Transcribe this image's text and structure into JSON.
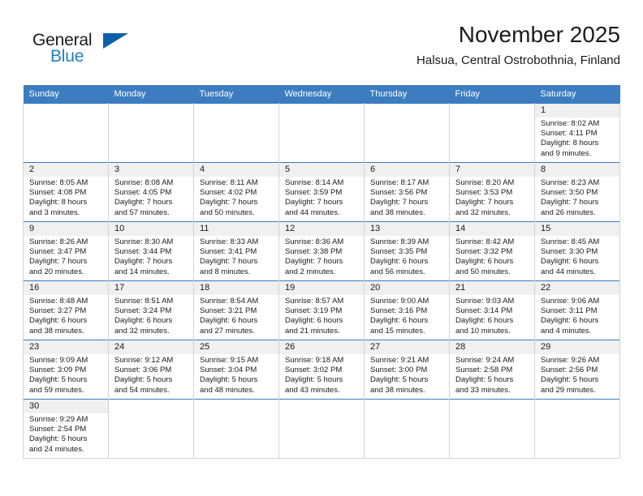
{
  "brand": {
    "name_top": "General",
    "name_bottom": "Blue",
    "accent_color": "#1f7fc4",
    "triangle_color": "#0c60aa",
    "triangle_icon": "triangle-icon"
  },
  "header": {
    "title": "November 2025",
    "subtitle": "Halsua, Central Ostrobothnia, Finland"
  },
  "calendar": {
    "header_bg": "#3b7dc0",
    "daynum_bg": "#f0f0f0",
    "grid_line": "#d4d4d4",
    "weekday_headers": [
      "Sunday",
      "Monday",
      "Tuesday",
      "Wednesday",
      "Thursday",
      "Friday",
      "Saturday"
    ],
    "weeks": [
      [
        {
          "blank": true
        },
        {
          "blank": true
        },
        {
          "blank": true
        },
        {
          "blank": true
        },
        {
          "blank": true
        },
        {
          "blank": true
        },
        {
          "day": "1",
          "sunrise": "Sunrise: 8:02 AM",
          "sunset": "Sunset: 4:11 PM",
          "daylight1": "Daylight: 8 hours",
          "daylight2": "and 9 minutes."
        }
      ],
      [
        {
          "day": "2",
          "sunrise": "Sunrise: 8:05 AM",
          "sunset": "Sunset: 4:08 PM",
          "daylight1": "Daylight: 8 hours",
          "daylight2": "and 3 minutes."
        },
        {
          "day": "3",
          "sunrise": "Sunrise: 8:08 AM",
          "sunset": "Sunset: 4:05 PM",
          "daylight1": "Daylight: 7 hours",
          "daylight2": "and 57 minutes."
        },
        {
          "day": "4",
          "sunrise": "Sunrise: 8:11 AM",
          "sunset": "Sunset: 4:02 PM",
          "daylight1": "Daylight: 7 hours",
          "daylight2": "and 50 minutes."
        },
        {
          "day": "5",
          "sunrise": "Sunrise: 8:14 AM",
          "sunset": "Sunset: 3:59 PM",
          "daylight1": "Daylight: 7 hours",
          "daylight2": "and 44 minutes."
        },
        {
          "day": "6",
          "sunrise": "Sunrise: 8:17 AM",
          "sunset": "Sunset: 3:56 PM",
          "daylight1": "Daylight: 7 hours",
          "daylight2": "and 38 minutes."
        },
        {
          "day": "7",
          "sunrise": "Sunrise: 8:20 AM",
          "sunset": "Sunset: 3:53 PM",
          "daylight1": "Daylight: 7 hours",
          "daylight2": "and 32 minutes."
        },
        {
          "day": "8",
          "sunrise": "Sunrise: 8:23 AM",
          "sunset": "Sunset: 3:50 PM",
          "daylight1": "Daylight: 7 hours",
          "daylight2": "and 26 minutes."
        }
      ],
      [
        {
          "day": "9",
          "sunrise": "Sunrise: 8:26 AM",
          "sunset": "Sunset: 3:47 PM",
          "daylight1": "Daylight: 7 hours",
          "daylight2": "and 20 minutes."
        },
        {
          "day": "10",
          "sunrise": "Sunrise: 8:30 AM",
          "sunset": "Sunset: 3:44 PM",
          "daylight1": "Daylight: 7 hours",
          "daylight2": "and 14 minutes."
        },
        {
          "day": "11",
          "sunrise": "Sunrise: 8:33 AM",
          "sunset": "Sunset: 3:41 PM",
          "daylight1": "Daylight: 7 hours",
          "daylight2": "and 8 minutes."
        },
        {
          "day": "12",
          "sunrise": "Sunrise: 8:36 AM",
          "sunset": "Sunset: 3:38 PM",
          "daylight1": "Daylight: 7 hours",
          "daylight2": "and 2 minutes."
        },
        {
          "day": "13",
          "sunrise": "Sunrise: 8:39 AM",
          "sunset": "Sunset: 3:35 PM",
          "daylight1": "Daylight: 6 hours",
          "daylight2": "and 56 minutes."
        },
        {
          "day": "14",
          "sunrise": "Sunrise: 8:42 AM",
          "sunset": "Sunset: 3:32 PM",
          "daylight1": "Daylight: 6 hours",
          "daylight2": "and 50 minutes."
        },
        {
          "day": "15",
          "sunrise": "Sunrise: 8:45 AM",
          "sunset": "Sunset: 3:30 PM",
          "daylight1": "Daylight: 6 hours",
          "daylight2": "and 44 minutes."
        }
      ],
      [
        {
          "day": "16",
          "sunrise": "Sunrise: 8:48 AM",
          "sunset": "Sunset: 3:27 PM",
          "daylight1": "Daylight: 6 hours",
          "daylight2": "and 38 minutes."
        },
        {
          "day": "17",
          "sunrise": "Sunrise: 8:51 AM",
          "sunset": "Sunset: 3:24 PM",
          "daylight1": "Daylight: 6 hours",
          "daylight2": "and 32 minutes."
        },
        {
          "day": "18",
          "sunrise": "Sunrise: 8:54 AM",
          "sunset": "Sunset: 3:21 PM",
          "daylight1": "Daylight: 6 hours",
          "daylight2": "and 27 minutes."
        },
        {
          "day": "19",
          "sunrise": "Sunrise: 8:57 AM",
          "sunset": "Sunset: 3:19 PM",
          "daylight1": "Daylight: 6 hours",
          "daylight2": "and 21 minutes."
        },
        {
          "day": "20",
          "sunrise": "Sunrise: 9:00 AM",
          "sunset": "Sunset: 3:16 PM",
          "daylight1": "Daylight: 6 hours",
          "daylight2": "and 15 minutes."
        },
        {
          "day": "21",
          "sunrise": "Sunrise: 9:03 AM",
          "sunset": "Sunset: 3:14 PM",
          "daylight1": "Daylight: 6 hours",
          "daylight2": "and 10 minutes."
        },
        {
          "day": "22",
          "sunrise": "Sunrise: 9:06 AM",
          "sunset": "Sunset: 3:11 PM",
          "daylight1": "Daylight: 6 hours",
          "daylight2": "and 4 minutes."
        }
      ],
      [
        {
          "day": "23",
          "sunrise": "Sunrise: 9:09 AM",
          "sunset": "Sunset: 3:09 PM",
          "daylight1": "Daylight: 5 hours",
          "daylight2": "and 59 minutes."
        },
        {
          "day": "24",
          "sunrise": "Sunrise: 9:12 AM",
          "sunset": "Sunset: 3:06 PM",
          "daylight1": "Daylight: 5 hours",
          "daylight2": "and 54 minutes."
        },
        {
          "day": "25",
          "sunrise": "Sunrise: 9:15 AM",
          "sunset": "Sunset: 3:04 PM",
          "daylight1": "Daylight: 5 hours",
          "daylight2": "and 48 minutes."
        },
        {
          "day": "26",
          "sunrise": "Sunrise: 9:18 AM",
          "sunset": "Sunset: 3:02 PM",
          "daylight1": "Daylight: 5 hours",
          "daylight2": "and 43 minutes."
        },
        {
          "day": "27",
          "sunrise": "Sunrise: 9:21 AM",
          "sunset": "Sunset: 3:00 PM",
          "daylight1": "Daylight: 5 hours",
          "daylight2": "and 38 minutes."
        },
        {
          "day": "28",
          "sunrise": "Sunrise: 9:24 AM",
          "sunset": "Sunset: 2:58 PM",
          "daylight1": "Daylight: 5 hours",
          "daylight2": "and 33 minutes."
        },
        {
          "day": "29",
          "sunrise": "Sunrise: 9:26 AM",
          "sunset": "Sunset: 2:56 PM",
          "daylight1": "Daylight: 5 hours",
          "daylight2": "and 29 minutes."
        }
      ],
      [
        {
          "day": "30",
          "sunrise": "Sunrise: 9:29 AM",
          "sunset": "Sunset: 2:54 PM",
          "daylight1": "Daylight: 5 hours",
          "daylight2": "and 24 minutes."
        },
        {
          "blank": true
        },
        {
          "blank": true
        },
        {
          "blank": true
        },
        {
          "blank": true
        },
        {
          "blank": true
        },
        {
          "blank": true
        }
      ]
    ]
  }
}
